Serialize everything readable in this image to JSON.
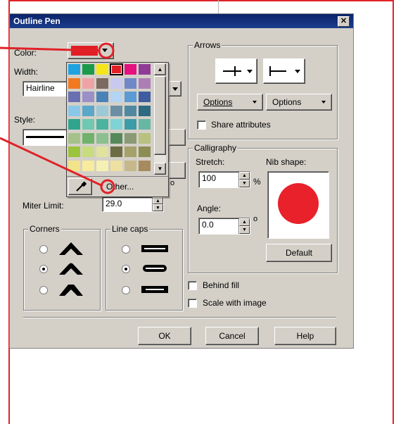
{
  "dialog": {
    "title": "Outline Pen",
    "close_glyph": "✕"
  },
  "left": {
    "color_label": "Color:",
    "width_label": "Width:",
    "width_value": "Hairline",
    "style_label": "Style:",
    "miter_label": "Miter Limit:",
    "miter_value": "29.0",
    "degree_symbol": "o"
  },
  "palette": {
    "other_label": "Other...",
    "colors": [
      [
        "#1fa3e0",
        "#1a9a4a",
        "#f5e61a",
        "#e11e25",
        "#e4117f",
        "#8f3c97"
      ],
      [
        "#f17a21",
        "#f0a3a5",
        "#7b6a5f",
        "#c7c9f0",
        "#6f88c8",
        "#ad7eb6"
      ],
      [
        "#6a6fb2",
        "#9b8fc7",
        "#4a82b7",
        "#b3d4f3",
        "#5b9ad3",
        "#3e5c9f"
      ],
      [
        "#8ac7e9",
        "#5aa7c9",
        "#9dc8d6",
        "#6c8ea4",
        "#4f88a0",
        "#2e6a82"
      ],
      [
        "#2fa58e",
        "#6fc8b0",
        "#4bb39f",
        "#7fd3d6",
        "#3c9ca8",
        "#66b7a4"
      ],
      [
        "#a6c18a",
        "#6fb26b",
        "#8cbf8f",
        "#55895b",
        "#8a9a74",
        "#b8c17f"
      ],
      [
        "#9bc33b",
        "#c8dc7e",
        "#e0e29e",
        "#6b6b44",
        "#a6a06a",
        "#8c8c55"
      ],
      [
        "#f3e38b",
        "#f6ec9c",
        "#f7f0b3",
        "#ede0a0",
        "#c7b88c",
        "#a58b5e"
      ]
    ]
  },
  "arrows": {
    "group_label": "Arrows",
    "options_left": "Options",
    "options_right": "Options",
    "share_attributes": "Share attributes"
  },
  "calligraphy": {
    "group_label": "Calligraphy",
    "stretch_label": "Stretch:",
    "stretch_value": "100",
    "percent": "%",
    "nib_label": "Nib shape:",
    "angle_label": "Angle:",
    "angle_value": "0.0",
    "degree_symbol": "o",
    "default_button": "Default",
    "nib_color": "#e8212a"
  },
  "corners": {
    "group_label": "Corners"
  },
  "linecaps": {
    "group_label": "Line caps"
  },
  "options": {
    "behind_fill": "Behind fill",
    "scale_with_image": "Scale with image"
  },
  "buttons": {
    "ok": "OK",
    "cancel": "Cancel",
    "help": "Help"
  },
  "accent_color": "#e02228",
  "selected_color": "#e11e25"
}
